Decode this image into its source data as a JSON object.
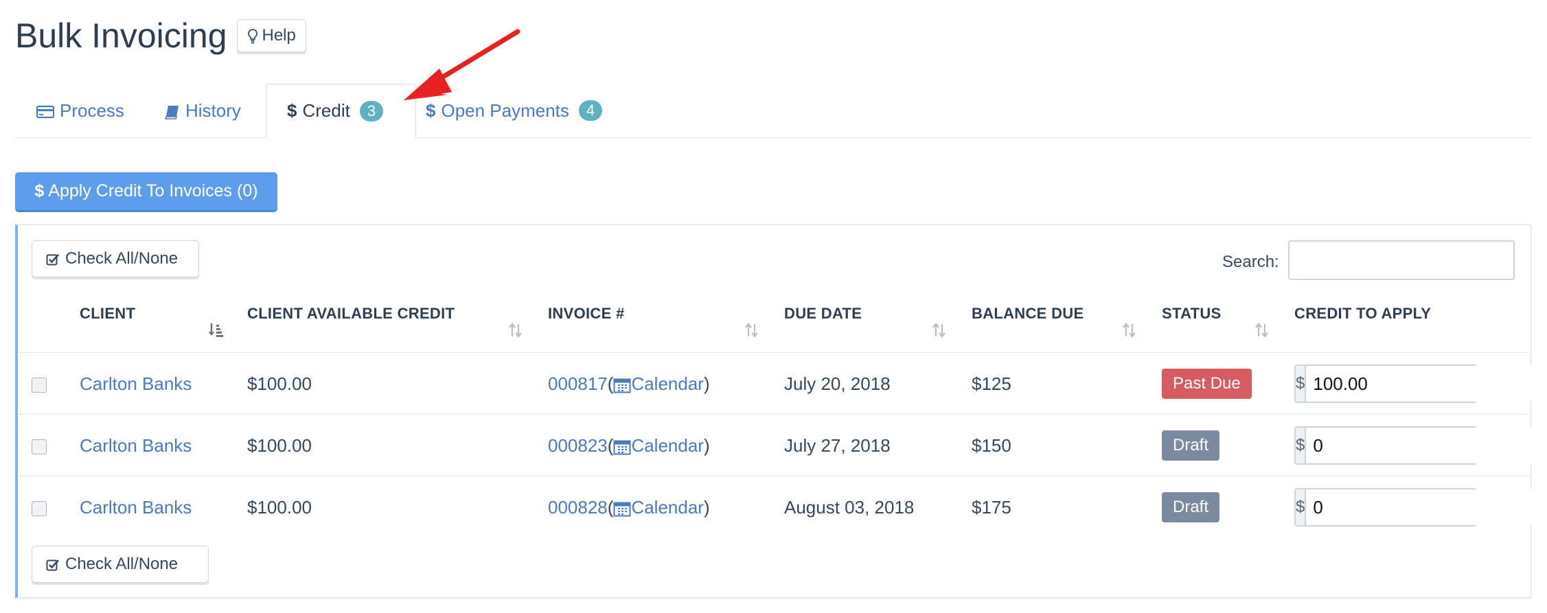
{
  "page": {
    "title": "Bulk Invoicing",
    "help_label": "Help"
  },
  "tabs": [
    {
      "label": "Process",
      "icon": "credit-card-icon",
      "active": false
    },
    {
      "label": "History",
      "icon": "book-icon",
      "active": false
    },
    {
      "label": "Credit",
      "icon": "dollar-icon",
      "active": true,
      "badge": "3"
    },
    {
      "label": "Open Payments",
      "icon": "dollar-icon",
      "active": false,
      "badge": "4"
    }
  ],
  "apply_button": {
    "label": "Apply Credit To Invoices (0)",
    "icon": "dollar-icon"
  },
  "check_all_label": "Check All/None",
  "search": {
    "label": "Search:",
    "value": "",
    "placeholder": ""
  },
  "table": {
    "columns": [
      "CLIENT",
      "CLIENT AVAILABLE CREDIT",
      "INVOICE #",
      "DUE DATE",
      "BALANCE DUE",
      "STATUS",
      "CREDIT TO APPLY"
    ],
    "rows": [
      {
        "client": "Carlton Banks",
        "available_credit": "$100.00",
        "invoice": "000817",
        "calendar": "Calendar",
        "due_date": "July 20, 2018",
        "balance_due": "$125",
        "status": "Past Due",
        "currency": "$",
        "credit_to_apply": "100.00"
      },
      {
        "client": "Carlton Banks",
        "available_credit": "$100.00",
        "invoice": "000823",
        "calendar": "Calendar",
        "due_date": "July 27, 2018",
        "balance_due": "$150",
        "status": "Draft",
        "currency": "$",
        "credit_to_apply": "0"
      },
      {
        "client": "Carlton Banks",
        "available_credit": "$100.00",
        "invoice": "000828",
        "calendar": "Calendar",
        "due_date": "August 03, 2018",
        "balance_due": "$175",
        "status": "Draft",
        "currency": "$",
        "credit_to_apply": "0"
      }
    ]
  },
  "colors": {
    "link": "#4a7bbf",
    "primary_button": "#5e9cec",
    "badge": "#5fb0c0",
    "past_due": "#d65b62",
    "draft": "#7c8a9f",
    "annotation_arrow": "#e8201f"
  }
}
